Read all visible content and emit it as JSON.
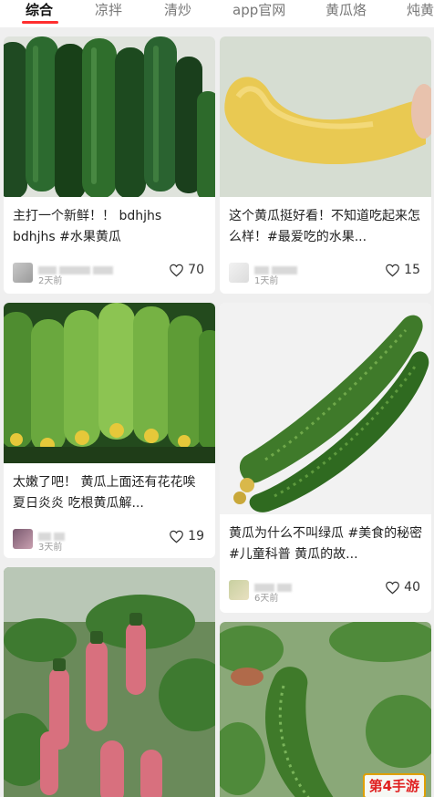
{
  "tabs": [
    "综合",
    "凉拌",
    "清炒",
    "app官网",
    "黄瓜烙",
    "炖黄"
  ],
  "active_tab": "综合",
  "posts": [
    {
      "title": "主打一个新鲜！！ bdhjhs bdhjhs #水果黄瓜",
      "time": "2天前",
      "likes": "70"
    },
    {
      "title": "这个黄瓜挺好看！不知道吃起来怎么样！#最爱吃的水果...",
      "time": "1天前",
      "likes": "15"
    },
    {
      "title": "太嫩了吧！ 黄瓜上面还有花花唉 夏日炎炎 吃根黄瓜解...",
      "time": "3天前",
      "likes": "19"
    },
    {
      "title": "黄瓜为什么不叫绿瓜 #美食的秘密 #儿童科普 黄瓜的故...",
      "time": "6天前",
      "likes": "40"
    }
  ],
  "watermark": "第4手游",
  "colors": {
    "accent": "#ff2f2f",
    "text": "#222222",
    "muted": "#9a9a9a",
    "background": "#efefef"
  }
}
